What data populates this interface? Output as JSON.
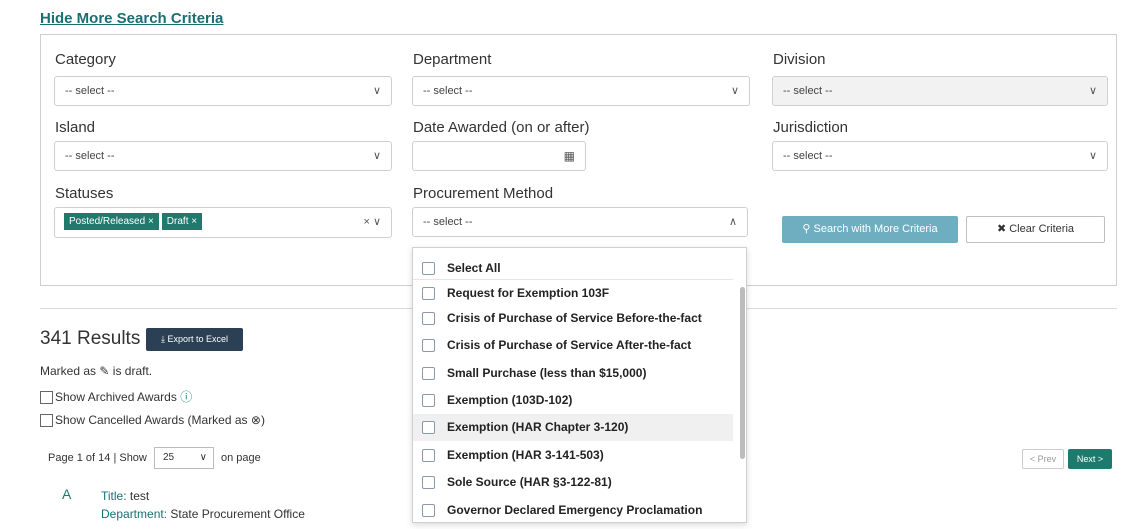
{
  "hide_link": "Hide More Search Criteria",
  "fields": {
    "category": {
      "label": "Category",
      "value": "-- select --"
    },
    "department": {
      "label": "Department",
      "value": "-- select --"
    },
    "division": {
      "label": "Division",
      "value": "-- select --"
    },
    "island": {
      "label": "Island",
      "value": "-- select --"
    },
    "date_awarded": {
      "label": "Date Awarded (on or after)",
      "value": ""
    },
    "jurisdiction": {
      "label": "Jurisdiction",
      "value": "-- select --"
    },
    "statuses": {
      "label": "Statuses",
      "tags": [
        "Posted/Released",
        "Draft"
      ]
    },
    "procurement": {
      "label": "Procurement Method",
      "value": "-- select --"
    }
  },
  "buttons": {
    "search": "Search with More Criteria",
    "clear": "Clear Criteria",
    "export": "Export to Excel",
    "prev": "< Prev",
    "next": "Next >"
  },
  "results": {
    "count_text": "341 Results",
    "marked_pre": "Marked as",
    "marked_post": "is draft.",
    "archived": "Show Archived Awards",
    "cancelled_pre": "Show Cancelled Awards (Marked as",
    "cancelled_post": ")"
  },
  "pager": {
    "page_text": "Page 1 of 14 | Show",
    "show_value": "25",
    "on_page": "on page"
  },
  "record": {
    "avatar": "A",
    "title_label": "Title:",
    "title_value": "test",
    "dept_label": "Department:",
    "dept_value": "State Procurement Office"
  },
  "dropdown_items": [
    "Select All",
    "Request for Exemption 103F",
    "Crisis of Purchase of Service Before-the-fact",
    "Crisis of Purchase of Service After-the-fact",
    "Small Purchase (less than $15,000)",
    "Exemption (103D-102)",
    "Exemption (HAR Chapter 3-120)",
    "Exemption (HAR 3-141-503)",
    "Sole Source (HAR §3-122-81)",
    "Governor Declared Emergency Proclamation"
  ],
  "colors": {
    "accent": "#1f7a6e",
    "search_btn": "#6eaec0",
    "export_btn": "#2b3f55"
  }
}
